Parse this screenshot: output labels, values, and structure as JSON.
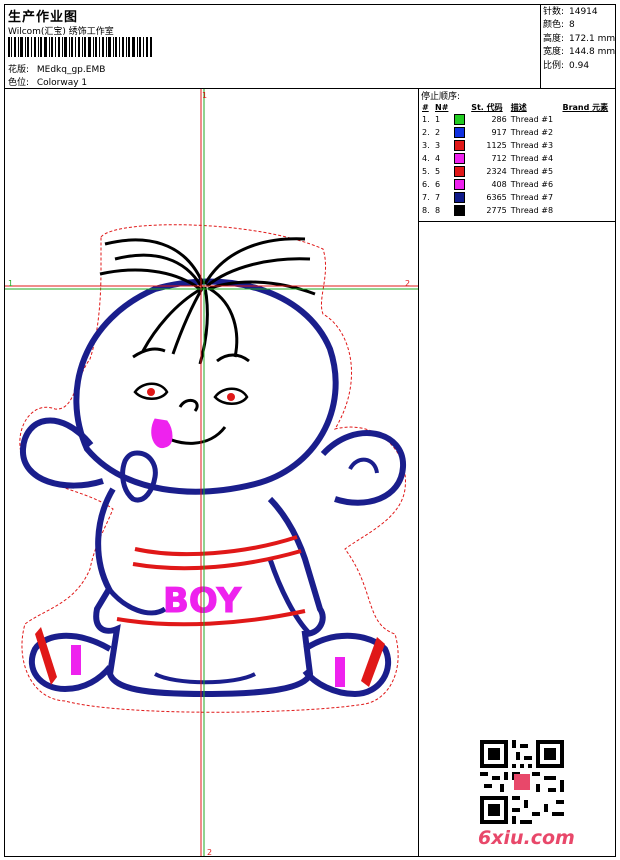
{
  "header": {
    "title": "生产作业图",
    "company": "Wilcom(汇宝) 绣饰工作室",
    "design_label": "花版:",
    "design_file": "MEdkq_gp.EMB",
    "color_label": "色位:",
    "colorway": "Colorway 1"
  },
  "stats": {
    "stitches_label": "针数:",
    "stitches": "14914",
    "colors_label": "颜色:",
    "colors": "8",
    "height_label": "高度:",
    "height": "172.1 mm",
    "width_label": "宽度:",
    "width": "144.8 mm",
    "scale_label": "比例:",
    "scale": "0.94"
  },
  "stop_sequence": {
    "title": "停止顺序:",
    "headers": [
      "#",
      "N#",
      "St.",
      "代码",
      "描述",
      "Brand",
      "元素"
    ],
    "rows": [
      {
        "idx": "1.",
        "n": "1",
        "color": "#22cc22",
        "stitches": "286",
        "desc": "Thread #1"
      },
      {
        "idx": "2.",
        "n": "2",
        "color": "#1030e0",
        "stitches": "917",
        "desc": "Thread #2"
      },
      {
        "idx": "3.",
        "n": "3",
        "color": "#e01818",
        "stitches": "1125",
        "desc": "Thread #3"
      },
      {
        "idx": "4.",
        "n": "4",
        "color": "#ee22ee",
        "stitches": "712",
        "desc": "Thread #4"
      },
      {
        "idx": "5.",
        "n": "5",
        "color": "#e01818",
        "stitches": "2324",
        "desc": "Thread #5"
      },
      {
        "idx": "6.",
        "n": "6",
        "color": "#ee22ee",
        "stitches": "408",
        "desc": "Thread #6"
      },
      {
        "idx": "7.",
        "n": "7",
        "color": "#101a8a",
        "stitches": "6365",
        "desc": "Thread #7"
      },
      {
        "idx": "8.",
        "n": "8",
        "color": "#000000",
        "stitches": "2775",
        "desc": "Thread #8"
      }
    ]
  },
  "design": {
    "axis_marks": [
      "1",
      "2",
      "1",
      "2"
    ],
    "text": "BOY"
  },
  "footer": {
    "logo": "6xiu.com"
  },
  "colors": {
    "navy": "#1a1e8c",
    "red": "#e01818",
    "magenta": "#ee22ee",
    "green": "#22aa22",
    "guide_red": "#e01818"
  }
}
